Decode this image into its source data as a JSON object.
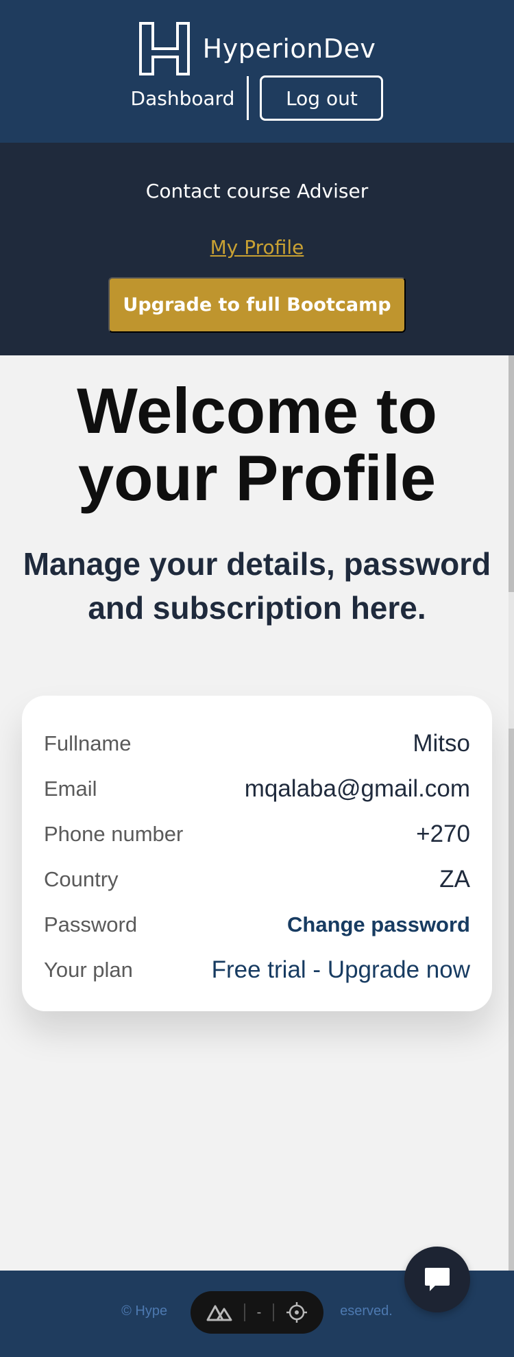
{
  "header": {
    "brand": "HyperionDev",
    "nav": {
      "dashboard": "Dashboard",
      "logout": "Log out"
    }
  },
  "subheader": {
    "contact": "Contact course Adviser",
    "my_profile": "My Profile",
    "upgrade": "Upgrade to full Bootcamp"
  },
  "hero": {
    "title_line1": "Welcome to",
    "title_line2": "your Profile",
    "subtitle_line1": "Manage your details, password",
    "subtitle_line2": "and subscription here."
  },
  "profile": {
    "rows": [
      {
        "label": "Fullname",
        "value": "Mitso"
      },
      {
        "label": "Email",
        "value": "mqalaba@gmail.com"
      },
      {
        "label": "Phone number",
        "value": "+270"
      },
      {
        "label": "Country",
        "value": "ZA"
      },
      {
        "label": "Password",
        "value": "Change password"
      },
      {
        "label": "Your plan",
        "value": "Free trial - Upgrade now"
      }
    ]
  },
  "footer": {
    "copyright_left": "© Hype",
    "copyright_right": "eserved."
  },
  "devtools": {
    "center_text": "-"
  },
  "icons": {
    "logo": "hyperiondev-logo-icon",
    "nuxt": "nuxt-icon",
    "target": "crosshair-icon",
    "chat": "chat-bubble-icon"
  },
  "colors": {
    "header_bg": "#1f3c5e",
    "subheader_bg": "#1f2a3c",
    "accent_gold": "#bf952e",
    "link_gold": "#c9a133",
    "link_blue": "#173b61"
  }
}
